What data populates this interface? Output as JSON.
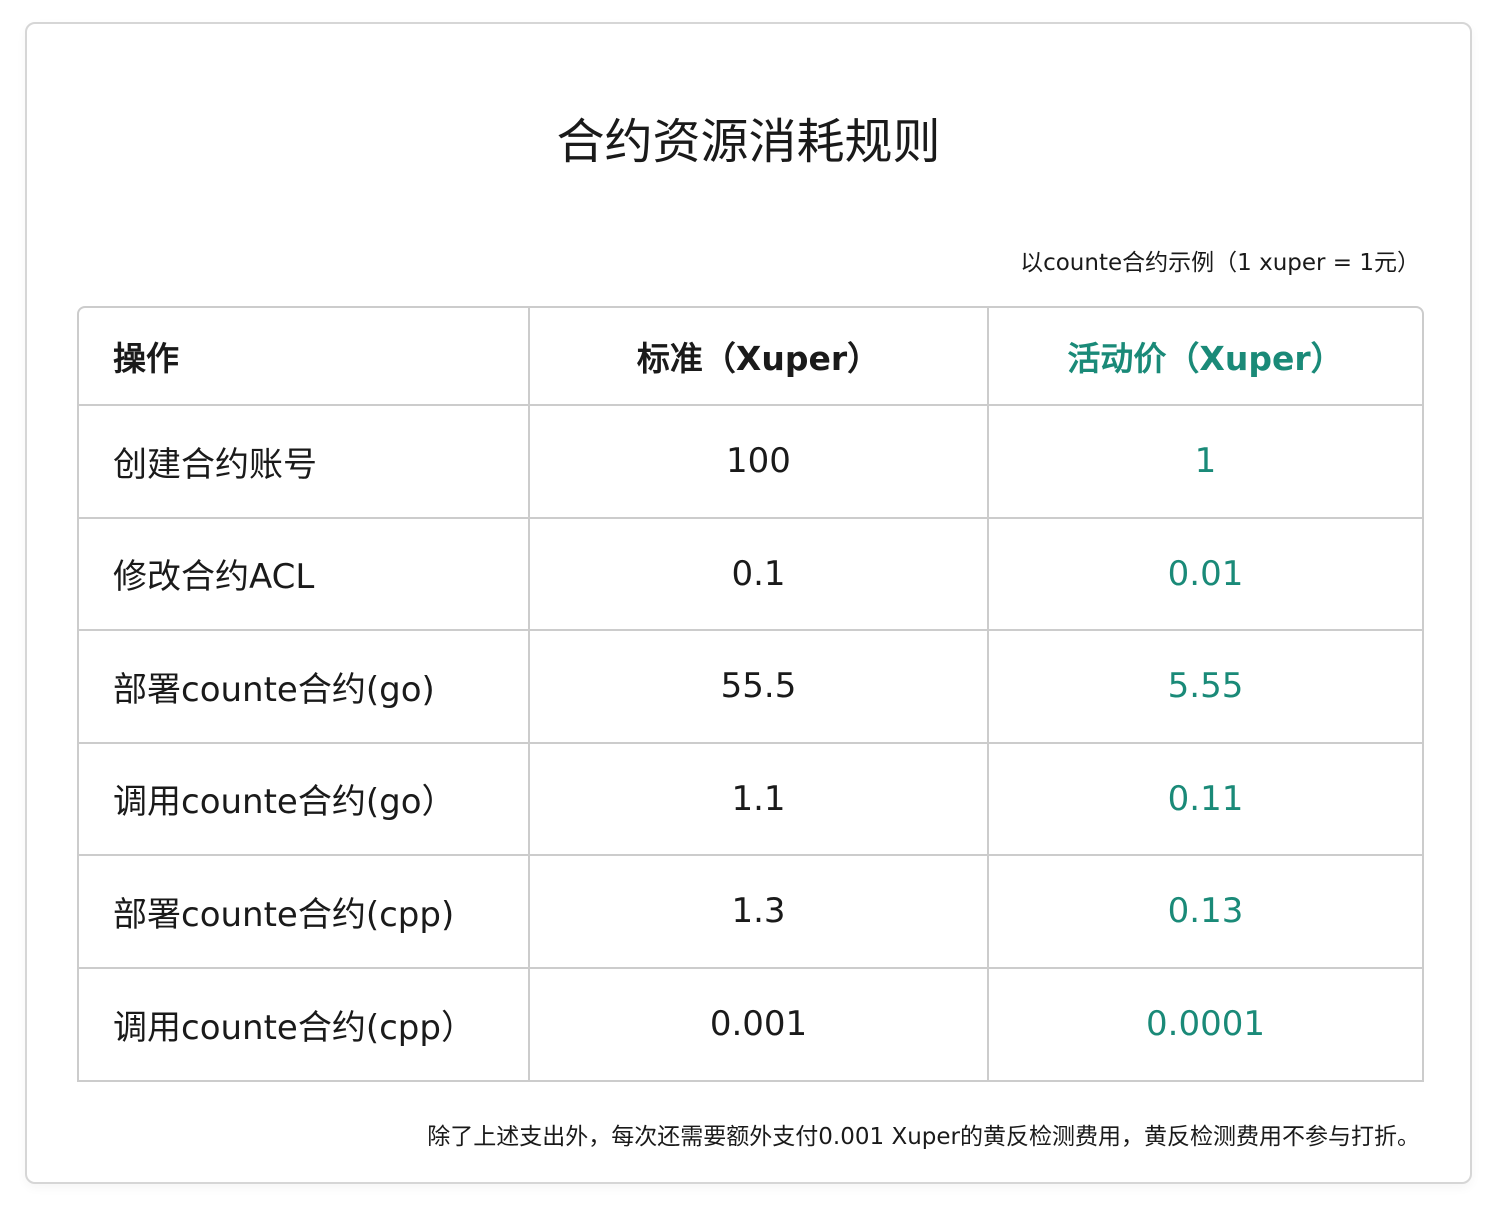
{
  "title": "合约资源消耗规则",
  "note_top": "以counte合约示例（1 xuper = 1元）",
  "table": {
    "headers": {
      "operation": "操作",
      "standard": "标准（Xuper）",
      "promo": "活动价（Xuper）"
    },
    "rows": [
      {
        "operation": "创建合约账号",
        "standard": "100",
        "promo": "1"
      },
      {
        "operation": "修改合约ACL",
        "standard": "0.1",
        "promo": "0.01"
      },
      {
        "operation": "部署counte合约(go)",
        "standard": "55.5",
        "promo": "5.55"
      },
      {
        "operation": "调用counte合约(go）",
        "standard": "1.1",
        "promo": "0.11"
      },
      {
        "operation": "部署counte合约(cpp)",
        "standard": "1.3",
        "promo": "0.13"
      },
      {
        "operation": "调用counte合约(cpp）",
        "standard": "0.001",
        "promo": "0.0001"
      }
    ]
  },
  "note_bottom": "除了上述支出外，每次还需要额外支付0.001 Xuper的黄反检测费用，黄反检测费用不参与打折。",
  "colors": {
    "promo_accent": "#1a8a78",
    "border": "#cccccc",
    "text": "#1a1a1a"
  }
}
